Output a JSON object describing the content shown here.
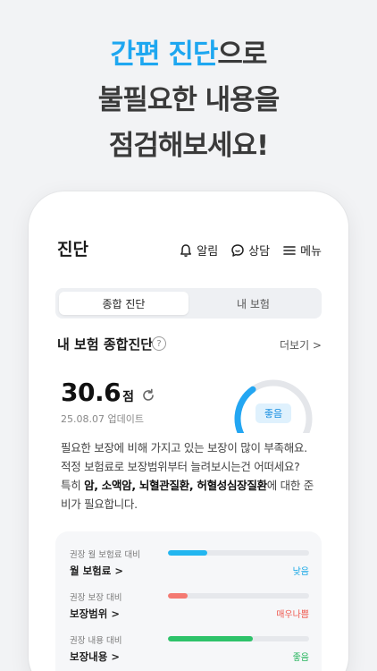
{
  "promo": {
    "line1_accent": "간편 진단",
    "line1_rest": "으로",
    "line2": "불필요한 내용을",
    "line3": "점검해보세요!"
  },
  "topbar": {
    "title": "진단",
    "menu": [
      {
        "icon": "bell-icon",
        "label": "알림"
      },
      {
        "icon": "chat-icon",
        "label": "상담"
      },
      {
        "icon": "hamburger-icon",
        "label": "메뉴"
      }
    ]
  },
  "tabs": [
    {
      "label": "종합 진단",
      "active": true
    },
    {
      "label": "내 보험",
      "active": false
    }
  ],
  "section": {
    "title": "내 보험 종합진단",
    "help": "?",
    "more": "더보기 >"
  },
  "score": {
    "value": "30.6",
    "unit": "점",
    "updated": "25.08.07 업데이트",
    "gauge_fraction": 0.37,
    "badge": "좋음"
  },
  "description": {
    "line1": "필요한 보장에 비해 가지고 있는 보장이 많이 부족해요.",
    "line2": "적정 보험료로 보장범위부터 늘려보시는건 어떠세요?",
    "line3_pre": "특히 ",
    "line3_bold1": "암, 소액암, 뇌혈관질환, 허혈성심장질환",
    "line3_post": "에 대한 준",
    "line4": "비가 필요합니다."
  },
  "metrics": [
    {
      "label": "권장 월 보험료 대비",
      "name": "월 보험료 >",
      "fraction": 0.28,
      "color": "#22b6f0",
      "status": "낮음",
      "status_color": "#18a8e6"
    },
    {
      "label": "권장 보장 대비",
      "name": "보장범위 >",
      "fraction": 0.14,
      "color": "#f47a72",
      "status": "매우나쁨",
      "status_color": "#ef5a50"
    },
    {
      "label": "권장 내용 대비",
      "name": "보장내용 >",
      "fraction": 0.6,
      "color": "#2ec36a",
      "status": "좋음",
      "status_color": "#22b35a"
    }
  ],
  "colors": {
    "accent": "#1ea7f0",
    "gauge_active": "#23a6f2",
    "gauge_track": "#e4e6ea"
  }
}
